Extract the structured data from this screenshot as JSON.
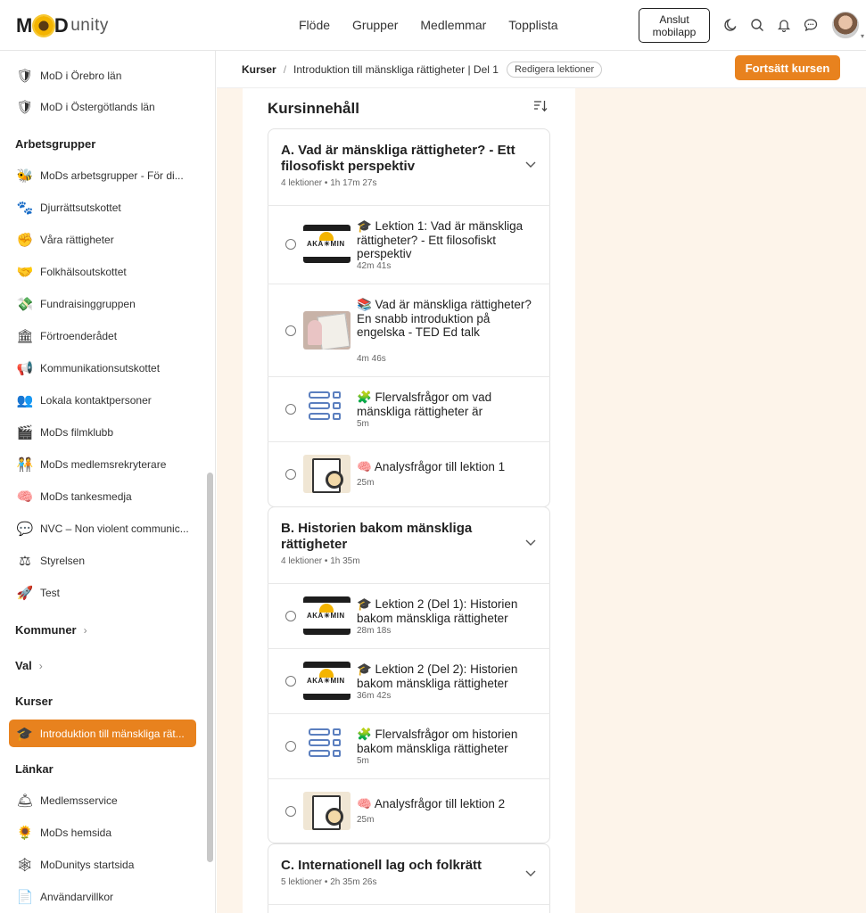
{
  "header": {
    "logo_mo": "M",
    "logo_d": "D",
    "logo_unity": "unity",
    "nav": [
      "Flöde",
      "Grupper",
      "Medlemmar",
      "Topplista"
    ],
    "app_button_line1": "Anslut",
    "app_button_line2": "mobilapp",
    "icons": [
      "moon-icon",
      "search-icon",
      "bell-icon",
      "chat-icon",
      "avatar"
    ]
  },
  "sidebar": {
    "items_top": [
      {
        "label": "MoD i Örebro län",
        "icon": "crest-icon"
      },
      {
        "label": "MoD i Östergötlands län",
        "icon": "crest-icon"
      }
    ],
    "heading_arbetsgrupper": "Arbetsgrupper",
    "arbetsgrupper": [
      {
        "label": "MoDs arbetsgrupper - För di...",
        "icon": "🐝"
      },
      {
        "label": "Djurrättsutskottet",
        "icon": "🐾"
      },
      {
        "label": "Våra rättigheter",
        "icon": "✊"
      },
      {
        "label": "Folkhälsoutskottet",
        "icon": "🤝"
      },
      {
        "label": "Fundraisinggruppen",
        "icon": "💸"
      },
      {
        "label": "Förtroenderådet",
        "icon": "🏛"
      },
      {
        "label": "Kommunikationsutskottet",
        "icon": "📢"
      },
      {
        "label": "Lokala kontaktpersoner",
        "icon": "👥"
      },
      {
        "label": "MoDs filmklubb",
        "icon": "🎬"
      },
      {
        "label": "MoDs medlemsrekryterare",
        "icon": "🧑‍🤝‍🧑"
      },
      {
        "label": "MoDs tankesmedja",
        "icon": "🧠"
      },
      {
        "label": "NVC – Non violent communic...",
        "icon": "💬"
      },
      {
        "label": "Styrelsen",
        "icon": "⚖"
      },
      {
        "label": "Test",
        "icon": "🚀"
      }
    ],
    "heading_kommuner": "Kommuner",
    "heading_val": "Val",
    "heading_kurser": "Kurser",
    "active_course": "Introduktion till mänskliga rät...",
    "heading_lankar": "Länkar",
    "lankar": [
      {
        "label": "Medlemsservice",
        "icon": "🛎"
      },
      {
        "label": "MoDs hemsida",
        "icon": "🌻"
      },
      {
        "label": "MoDunitys startsida",
        "icon": "🕸"
      },
      {
        "label": "Användarvillkor",
        "icon": "📄"
      }
    ]
  },
  "breadcrumb": {
    "root": "Kurser",
    "current": "Introduktion till mänskliga rättigheter | Del 1",
    "edit_label": "Redigera lektioner",
    "continue_label": "Fortsätt kursen"
  },
  "course": {
    "title": "Kursinnehåll",
    "sections": [
      {
        "title": "A. Vad är mänskliga rättigheter? - Ett filosofiskt perspektiv",
        "meta": "4 lektioner • 1h 17m 27s",
        "lessons": [
          {
            "title": "🎓 Lektion 1: Vad är mänskliga rättigheter? - Ett filosofiskt perspektiv",
            "duration": "42m 41s",
            "thumb": "akademin"
          },
          {
            "title": "📚 Vad är mänskliga rättigheter? En snabb introduktion på engelska - TED Ed talk",
            "duration": "4m 46s",
            "thumb": "ted"
          },
          {
            "title": "🧩 Flervalsfrågor om vad mänskliga rättigheter är",
            "duration": "5m",
            "thumb": "quiz"
          },
          {
            "title": "🧠 Analysfrågor till lektion 1",
            "duration": "25m",
            "thumb": "analysis"
          }
        ]
      },
      {
        "title": "B. Historien bakom mänskliga rättigheter",
        "meta": "4 lektioner • 1h 35m",
        "lessons": [
          {
            "title": "🎓 Lektion 2 (Del 1): Historien bakom mänskliga rättigheter",
            "duration": "28m 18s",
            "thumb": "akademin"
          },
          {
            "title": "🎓 Lektion 2 (Del 2): Historien bakom mänskliga rättigheter",
            "duration": "36m 42s",
            "thumb": "akademin"
          },
          {
            "title": "🧩 Flervalsfrågor om historien bakom mänskliga rättigheter",
            "duration": "5m",
            "thumb": "quiz"
          },
          {
            "title": "🧠 Analysfrågor till lektion 2",
            "duration": "25m",
            "thumb": "analysis"
          }
        ]
      },
      {
        "title": "C. Internationell lag och folkrätt",
        "meta": "5 lektioner • 2h 35m 26s",
        "lessons": []
      }
    ]
  },
  "colors": {
    "accent": "#e8821e",
    "content_bg": "#fdf4ea"
  }
}
